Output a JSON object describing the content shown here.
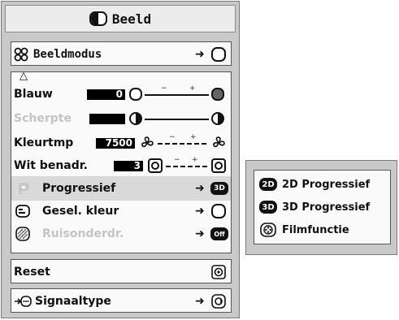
{
  "menu": {
    "title": "Beeld",
    "rows": {
      "beeldmodus": {
        "label": "Beeldmodus",
        "arrow": "➜"
      },
      "blauw": {
        "label": "Blauw",
        "value": "0"
      },
      "scherpte": {
        "label": "Scherpte"
      },
      "kleurtmp": {
        "label": "Kleurtmp",
        "value": "7500"
      },
      "wit": {
        "label": "Wit benadr.",
        "value": "3"
      },
      "progressief": {
        "label": "Progressief",
        "arrow": "➜",
        "icon_text": "3D"
      },
      "gesel": {
        "label": "Gesel. kleur",
        "arrow": "➜"
      },
      "ruis": {
        "label": "Ruisonderdr.",
        "arrow": "➜",
        "icon_text": "Off"
      },
      "reset": {
        "label": "Reset"
      },
      "signaal": {
        "label": "Signaaltype",
        "arrow": "➜"
      }
    },
    "slider_marks": {
      "minus": "−",
      "plus": "+"
    },
    "up_indicator": "△"
  },
  "submenu": {
    "items": [
      {
        "badge": "2D",
        "label": "2D Progressief"
      },
      {
        "badge": "3D",
        "label": "3D Progressief"
      },
      {
        "badge": "",
        "label": "Filmfunctie"
      }
    ]
  },
  "colors": {
    "panel": "#c9c9c9",
    "box": "#fafafa",
    "dim_text": "#c4c4c4"
  }
}
